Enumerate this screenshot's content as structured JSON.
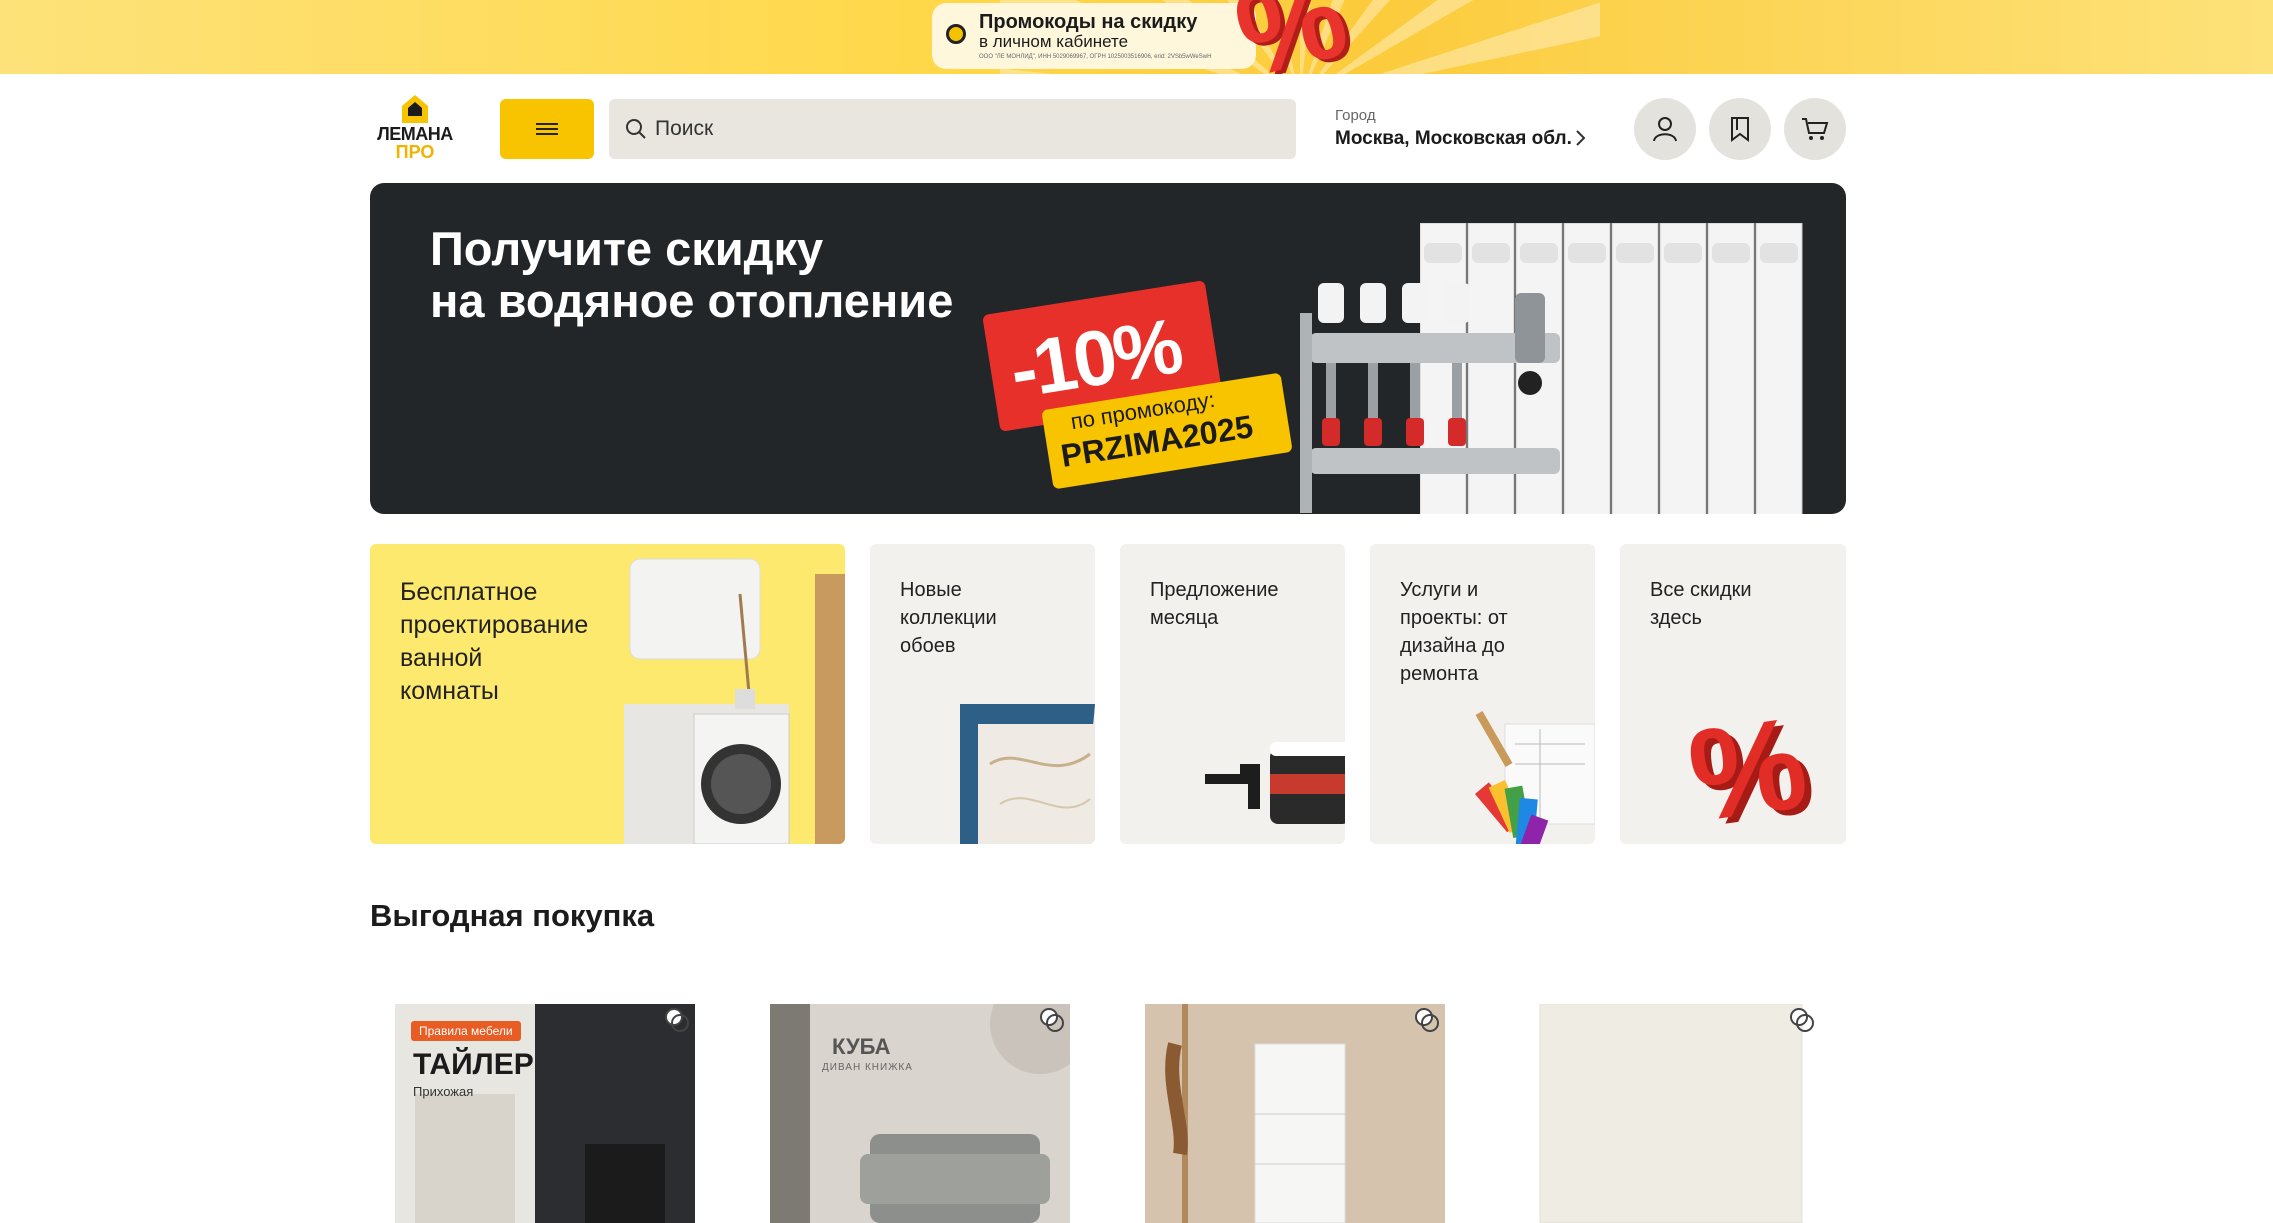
{
  "promo_strip": {
    "title": "Промокоды на скидку",
    "subtitle": "в личном кабинете",
    "legal": "ООО \"ЛЕ МОНЛИД\", ИНН 5029069967, ОГРН 1025003516906, erid: 2VSb5wWeSwH",
    "percent": "%"
  },
  "header": {
    "logo_line1": "ЛЕМАНА",
    "logo_line2": "ПРО",
    "search_placeholder": "Поиск",
    "city_label": "Город",
    "city_value": "Москва, Московская обл."
  },
  "hero": {
    "title_line1": "Получите скидку",
    "title_line2": "на водяное отопление",
    "discount": "-10%",
    "promo_label": "по промокоду:",
    "promo_code": "PRZIMA2025"
  },
  "tiles": [
    {
      "label": "Бесплатное\nпроектирование\nванной\nкомнаты"
    },
    {
      "label": "Новые\nколлекции\nобоев"
    },
    {
      "label": "Предложение\nмесяца"
    },
    {
      "label": "Услуги и\nпроекты: от\nдизайна до\nремонта"
    },
    {
      "label": "Все скидки\nздесь"
    }
  ],
  "section": {
    "title": "Выгодная покупка"
  },
  "products": [
    {
      "badge": "Правила мебели",
      "name": "ТАЙЛЕР",
      "subtitle": "Прихожая"
    },
    {
      "name": "КУБА",
      "subtitle": "ДИВАН КНИЖКА"
    },
    {
      "name": ""
    },
    {
      "name": ""
    }
  ],
  "colors": {
    "accent": "#f8c400",
    "hero_bg": "#232628",
    "tile_yellow": "#fde96e",
    "tile_gray": "#f2f1ee",
    "promo_red": "#e8302a"
  }
}
